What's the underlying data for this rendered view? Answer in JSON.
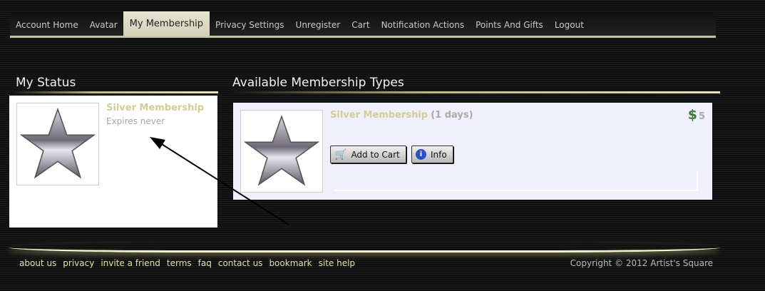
{
  "nav": {
    "items": [
      "Account Home",
      "Avatar",
      "My Membership",
      "Privacy Settings",
      "Unregister",
      "Cart",
      "Notification Actions",
      "Points And Gifts",
      "Logout"
    ],
    "active": 2
  },
  "status": {
    "heading": "My Status",
    "membership": "Silver Membership",
    "expires": "Expires never"
  },
  "available": {
    "heading": "Available Membership Types",
    "item": {
      "name": "Silver Membership",
      "duration": "(1 days)",
      "currency": "$",
      "price": "5",
      "add_to_cart": "Add to Cart",
      "info": "Info"
    }
  },
  "footer": {
    "links": [
      "about us",
      "privacy",
      "invite a friend",
      "terms",
      "faq",
      "contact us",
      "bookmark",
      "site help"
    ],
    "copyright": "Copyright © 2012 Artist's Square"
  },
  "colors": {
    "accent": "#d2cd93",
    "price": "#3a7a3a",
    "panel_bg": "#f0f0fc"
  }
}
